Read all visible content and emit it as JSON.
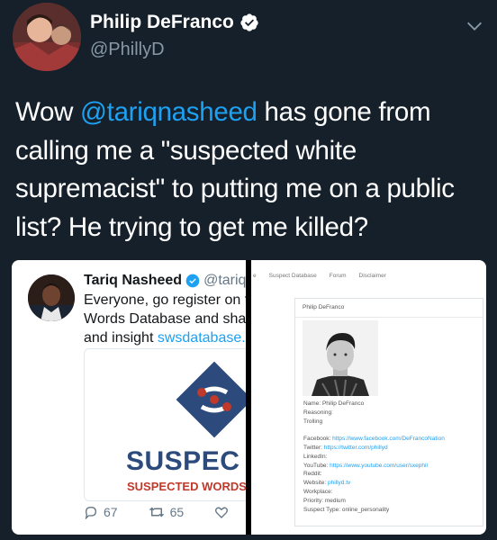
{
  "tweet": {
    "display_name": "Philip DeFranco",
    "handle": "@PhillyD",
    "text_mention": "@tariqnasheed",
    "text_rest": " has gone from calling me a \"suspected white supremacist\" to putting me on a public list? He trying to get me killed?",
    "text_prefix": "Wow "
  },
  "embedded_tweet": {
    "name": "Tariq Nasheed",
    "handle": "@tariqna",
    "line1": "Everyone, go register on th",
    "line2": "Words Database and share",
    "line3_prefix": "and insight  ",
    "line3_link": "swsdatabase.",
    "card_big": "SUSPEC",
    "card_sub": "SUSPECTED WORDS D",
    "replies": "67",
    "retweets": "65"
  },
  "database_page": {
    "nav_partial": "e",
    "nav": [
      "Suspect Database",
      "Forum",
      "Disclaimer"
    ],
    "title": "Philip DeFranco",
    "fields": [
      {
        "label": "Name: ",
        "value": "Philip DeFranco",
        "link": false
      },
      {
        "label": "Reasoning:",
        "value": "",
        "link": false
      },
      {
        "label": "Trolling",
        "value": "",
        "link": false
      },
      {
        "label": "",
        "value": "",
        "link": false
      },
      {
        "label": "Facebook: ",
        "value": "https://www.facebook.com/DeFrancoNation",
        "link": true
      },
      {
        "label": "Twitter: ",
        "value": "https://twitter.com/phillyd",
        "link": true
      },
      {
        "label": "LinkedIn:",
        "value": "",
        "link": false
      },
      {
        "label": "YouTube: ",
        "value": "https://www.youtube.com/user/sxephil",
        "link": true
      },
      {
        "label": "Reddit:",
        "value": "",
        "link": false
      },
      {
        "label": "Website: ",
        "value": "phillyd.tv",
        "link": true
      },
      {
        "label": "Workplace:",
        "value": "",
        "link": false
      },
      {
        "label": "Priority: ",
        "value": "medium",
        "link": false
      },
      {
        "label": "Suspect Type: ",
        "value": "online_personality",
        "link": false
      }
    ]
  },
  "colors": {
    "background": "#15202b",
    "accent": "#1da1f2",
    "muted": "#8899a6"
  },
  "icons": [
    "verified-badge-icon",
    "chevron-down-icon",
    "reply-icon",
    "retweet-icon",
    "like-icon"
  ]
}
